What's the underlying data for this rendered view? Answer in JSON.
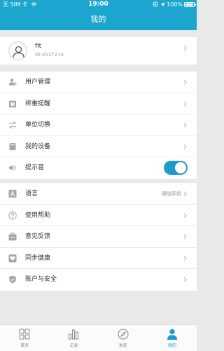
{
  "status_bar": {
    "carrier": "无 SIM 卡",
    "time": "19:00",
    "battery": "100%",
    "battery_level": 1.0
  },
  "header": {
    "title": "我的"
  },
  "profile": {
    "name": "fit",
    "id": "ID:4537214"
  },
  "menu": [
    {
      "label": "用户管理",
      "icon": "user-management-icon"
    },
    {
      "label": "称重提醒",
      "icon": "alarm-clock-icon"
    },
    {
      "label": "单位切换",
      "icon": "swap-arrows-icon"
    },
    {
      "label": "我的设备",
      "icon": "device-icon"
    },
    {
      "label": "提示音",
      "icon": "speaker-icon",
      "toggle_on": true
    }
  ],
  "menu2": [
    {
      "label": "语言",
      "value": "跟随系统",
      "icon": "language-icon"
    },
    {
      "label": "使用帮助",
      "icon": "help-icon"
    },
    {
      "label": "意见反馈",
      "icon": "feedback-icon"
    },
    {
      "label": "同步健康",
      "icon": "health-sync-icon"
    },
    {
      "label": "账户与安全",
      "icon": "shield-icon"
    }
  ],
  "tabs": [
    {
      "label": "首页",
      "icon": "home-grid-icon",
      "active": false
    },
    {
      "label": "记录",
      "icon": "bar-chart-icon",
      "active": false
    },
    {
      "label": "发现",
      "icon": "compass-icon",
      "active": false
    },
    {
      "label": "我的",
      "icon": "person-icon",
      "active": true
    }
  ],
  "colors": {
    "accent": "#1ca5cf",
    "toggle": "#1f9ac9",
    "background": "#e9e9e9",
    "icon_gray": "#a6a6a6"
  }
}
